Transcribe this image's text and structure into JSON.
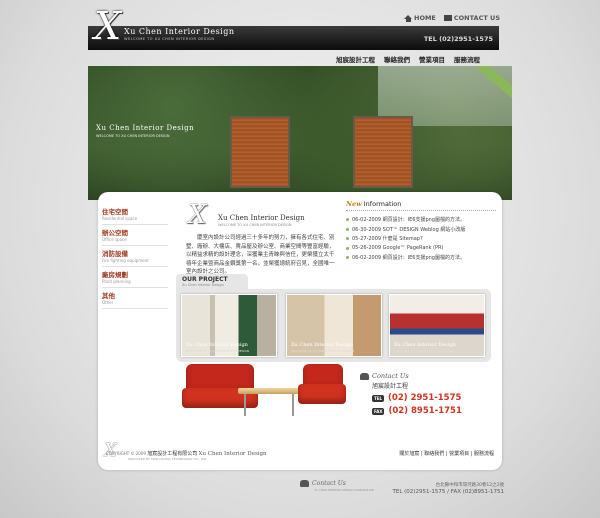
{
  "header": {
    "logo_glyph": "X",
    "brand_title": "Xu Chen Interior Design",
    "brand_subtitle": "WELCOME TO XU CHEN INTERIOR DESIGN",
    "tel": "TEL (02)2951-1575",
    "links": [
      {
        "label": "HOME",
        "icon": "home-icon"
      },
      {
        "label": "CONTACT US",
        "icon": "mail-icon"
      }
    ]
  },
  "nav": {
    "items": [
      "旭宸設計工程",
      "聯絡我們",
      "營業項目",
      "服務流程"
    ]
  },
  "hero": {
    "title": "Xu Chen Interior Design",
    "subtitle": "WELCOME TO XU CHEN INTERIOR DESIGN"
  },
  "sidebar": {
    "items": [
      {
        "label": "住宅空間",
        "sub": "Residential space"
      },
      {
        "label": "辦公空間",
        "sub": "Office space"
      },
      {
        "label": "消防設備",
        "sub": "Fire fighting equipment"
      },
      {
        "label": "廠房規劃",
        "sub": "Plant planning"
      },
      {
        "label": "其他",
        "sub": "Other"
      }
    ]
  },
  "intro": {
    "logo_glyph": "X",
    "title": "Xu Chen Interior Design",
    "subtitle": "WELCOME TO XU CHEN INTERIOR DESIGN",
    "text": "　　慶室內設計公司經過三十多年的努力，擁有各式住宅、別墅、廠辦、大樓店、賣品屋及辦公室、商業空間等豐富經驗，以精益求精的設計理念，深獲業主青睞與信任，更榮獲立太千禧年企業暨商品金鑽獎第一名，並榮獲總統府召見，全國唯一室內設計之公司。"
  },
  "news": {
    "head_new": "New",
    "head_label": "Information",
    "items": [
      "06-02-2009 網頁設計：IE6支援png圖檔的方法。",
      "06-30-2009 SOT™ DESIGN Weblog 網站小改版",
      "05-27-2009 什麼是 Sitemap?",
      "05-26-2009 Google™ PageRank (PR)",
      "06-02-2009 網頁設計：IE6支援png圖檔的方法。"
    ]
  },
  "project": {
    "tab_title": "OUR PROJECT",
    "tab_sub": "Xu Chen Interior Design",
    "thumbs": [
      {
        "caption": "Xu Chen Interior Design",
        "sub": "WELCOME TO XU CHEN INTERIOR DESIGN"
      },
      {
        "caption": "Xu Chen Interior Design",
        "sub": "WELCOME TO XU CHEN INTERIOR DESIGN"
      },
      {
        "caption": "Xu Chen Interior Design",
        "sub": "WELCOME TO XU CHEN INTERIOR DESIGN"
      }
    ]
  },
  "contact": {
    "heading": "Contact Us",
    "company": "旭宸設計工程",
    "tel_tag": "TEL",
    "tel": "(02) 2951-1575",
    "fax_tag": "FAX",
    "fax": "(02) 8951-1751"
  },
  "footer": {
    "logo_glyph": "X",
    "copyright": "COPYRIGHT © 2009",
    "company": "旭宸設計工程有限公司",
    "brand": "Xu Chen Interior Design",
    "produced": "PRODUCED BY STAR DIGITAL TECHNOLOGY CO., LTD.",
    "nav": "關於旭宸 | 聯絡我們 | 營業項目 | 服務流程"
  },
  "bottom": {
    "heading": "Contact Us",
    "sub": "XU CHEN INTERIOR DESIGN CORPORATION",
    "address": "台北縣中和市環河路30巷12之2號",
    "telfax": "TEL (02)2951-1575 / FAX (02)8951-1751"
  }
}
